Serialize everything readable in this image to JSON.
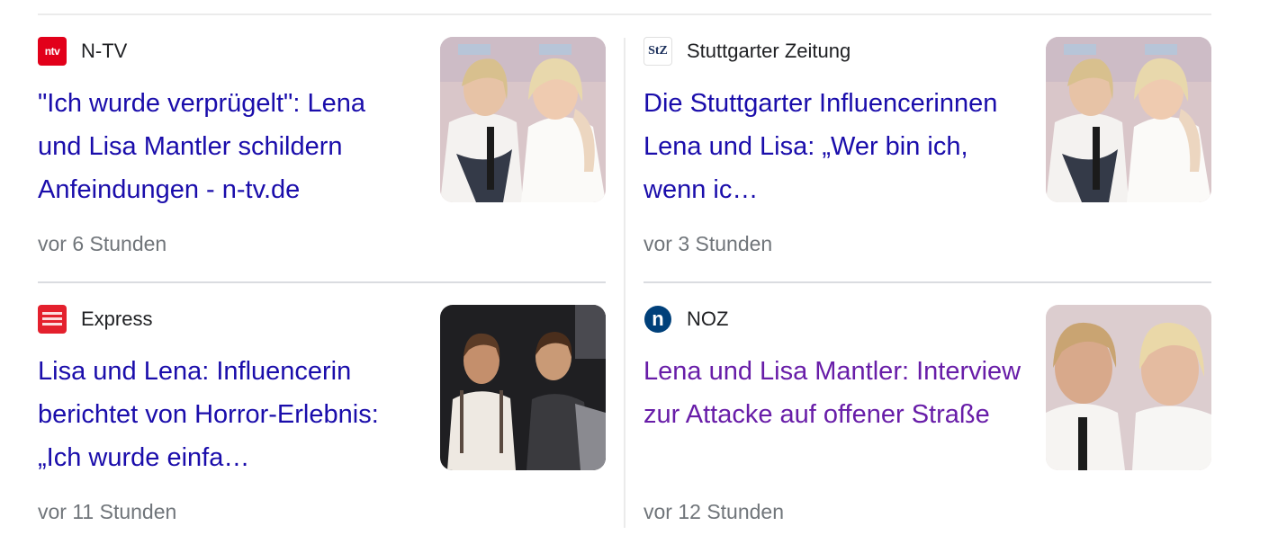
{
  "articles": [
    {
      "source": "N-TV",
      "logo_text": "ntv",
      "logo_icon": "ntv-logo-icon",
      "logo_color": "#e2001a",
      "headline": "\"Ich wurde verprügelt\": Lena und Lisa Mantler schildern Anfeindungen - n-tv.de",
      "time": "vor 6 Stunden",
      "visited": false
    },
    {
      "source": "Stuttgarter Zeitung",
      "logo_text": "StZ",
      "logo_icon": "stz-logo-icon",
      "logo_color": "#1a2e5a",
      "headline": "Die Stuttgarter Influencerinnen Lena und Lisa: „Wer bin ich, wenn ic…",
      "time": "vor 3 Stunden",
      "visited": false
    },
    {
      "source": "Express",
      "logo_text": "",
      "logo_icon": "express-logo-icon",
      "logo_color": "#e4202d",
      "headline": "Lisa und Lena: Influencerin berichtet von Horror-Erlebnis: „Ich wurde einfa…",
      "time": "vor 11 Stunden",
      "visited": false
    },
    {
      "source": "NOZ",
      "logo_text": "n",
      "logo_icon": "noz-logo-icon",
      "logo_color": "#00407a",
      "headline": "Lena und Lisa Mantler: Interview zur Attacke auf offener Straße",
      "time": "vor 12 Stunden",
      "visited": true
    }
  ],
  "colors": {
    "link": "#1a0dab",
    "visited_link": "#681da8",
    "meta_text": "#70757a",
    "divider": "#dadce0"
  }
}
